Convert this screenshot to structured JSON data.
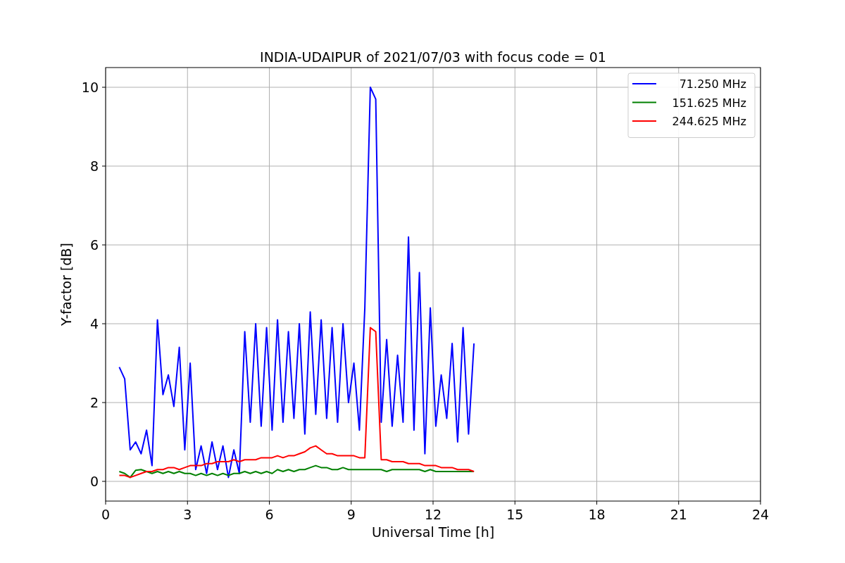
{
  "figure": {
    "chart_data": {
      "type": "line",
      "title": "INDIA-UDAIPUR of 2021/07/03 with focus code = 01",
      "xlabel": "Universal Time [h]",
      "ylabel": "Y-factor [dB]",
      "xlim": [
        0,
        24
      ],
      "ylim": [
        -0.5,
        10.5
      ],
      "xticks": [
        0,
        3,
        6,
        9,
        12,
        15,
        18,
        21,
        24
      ],
      "yticks": [
        0,
        2,
        4,
        6,
        8,
        10
      ],
      "grid": true,
      "legend": "upper right",
      "x": [
        0.5,
        0.7,
        0.9,
        1.1,
        1.3,
        1.5,
        1.7,
        1.9,
        2.1,
        2.3,
        2.5,
        2.7,
        2.9,
        3.1,
        3.3,
        3.5,
        3.7,
        3.9,
        4.1,
        4.3,
        4.5,
        4.7,
        4.9,
        5.1,
        5.3,
        5.5,
        5.7,
        5.9,
        6.1,
        6.3,
        6.5,
        6.7,
        6.9,
        7.1,
        7.3,
        7.5,
        7.7,
        7.9,
        8.1,
        8.3,
        8.5,
        8.7,
        8.9,
        9.1,
        9.3,
        9.5,
        9.7,
        9.9,
        10.1,
        10.3,
        10.5,
        10.7,
        10.9,
        11.1,
        11.3,
        11.5,
        11.7,
        11.9,
        12.1,
        12.3,
        12.5,
        12.7,
        12.9,
        13.1,
        13.3,
        13.5
      ],
      "series": [
        {
          "name": "71.250 MHz",
          "color": "#0000ff",
          "values": [
            2.9,
            2.6,
            0.8,
            1.0,
            0.7,
            1.3,
            0.4,
            4.1,
            2.2,
            2.7,
            1.9,
            3.4,
            0.8,
            3.0,
            0.3,
            0.9,
            0.2,
            1.0,
            0.3,
            0.9,
            0.1,
            0.8,
            0.2,
            3.8,
            1.5,
            4.0,
            1.4,
            3.9,
            1.3,
            4.1,
            1.5,
            3.8,
            1.6,
            4.0,
            1.2,
            4.3,
            1.7,
            4.1,
            1.6,
            3.9,
            1.5,
            4.0,
            2.0,
            3.0,
            1.3,
            4.4,
            10.0,
            9.7,
            1.5,
            3.6,
            1.4,
            3.2,
            1.5,
            6.2,
            1.3,
            5.3,
            0.7,
            4.4,
            1.4,
            2.7,
            1.6,
            3.5,
            1.0,
            3.9,
            1.2,
            3.5
          ]
        },
        {
          "name": "151.625 MHz",
          "color": "#008000",
          "values": [
            0.25,
            0.2,
            0.1,
            0.28,
            0.3,
            0.25,
            0.2,
            0.25,
            0.2,
            0.25,
            0.2,
            0.25,
            0.2,
            0.2,
            0.15,
            0.2,
            0.15,
            0.2,
            0.15,
            0.2,
            0.15,
            0.2,
            0.2,
            0.25,
            0.2,
            0.25,
            0.2,
            0.25,
            0.2,
            0.3,
            0.25,
            0.3,
            0.25,
            0.3,
            0.3,
            0.35,
            0.4,
            0.35,
            0.35,
            0.3,
            0.3,
            0.35,
            0.3,
            0.3,
            0.3,
            0.3,
            0.3,
            0.3,
            0.3,
            0.25,
            0.3,
            0.3,
            0.3,
            0.3,
            0.3,
            0.3,
            0.25,
            0.3,
            0.25,
            0.25,
            0.25,
            0.25,
            0.25,
            0.25,
            0.25,
            0.25
          ]
        },
        {
          "name": "244.625 MHz",
          "color": "#ff0000",
          "values": [
            0.15,
            0.15,
            0.1,
            0.15,
            0.2,
            0.25,
            0.25,
            0.3,
            0.3,
            0.35,
            0.35,
            0.3,
            0.35,
            0.4,
            0.4,
            0.4,
            0.45,
            0.45,
            0.5,
            0.5,
            0.5,
            0.55,
            0.5,
            0.55,
            0.55,
            0.55,
            0.6,
            0.6,
            0.6,
            0.65,
            0.6,
            0.65,
            0.65,
            0.7,
            0.75,
            0.85,
            0.9,
            0.8,
            0.7,
            0.7,
            0.65,
            0.65,
            0.65,
            0.65,
            0.6,
            0.6,
            3.9,
            3.8,
            0.55,
            0.55,
            0.5,
            0.5,
            0.5,
            0.45,
            0.45,
            0.45,
            0.4,
            0.4,
            0.4,
            0.35,
            0.35,
            0.35,
            0.3,
            0.3,
            0.3,
            0.25
          ]
        }
      ]
    }
  }
}
